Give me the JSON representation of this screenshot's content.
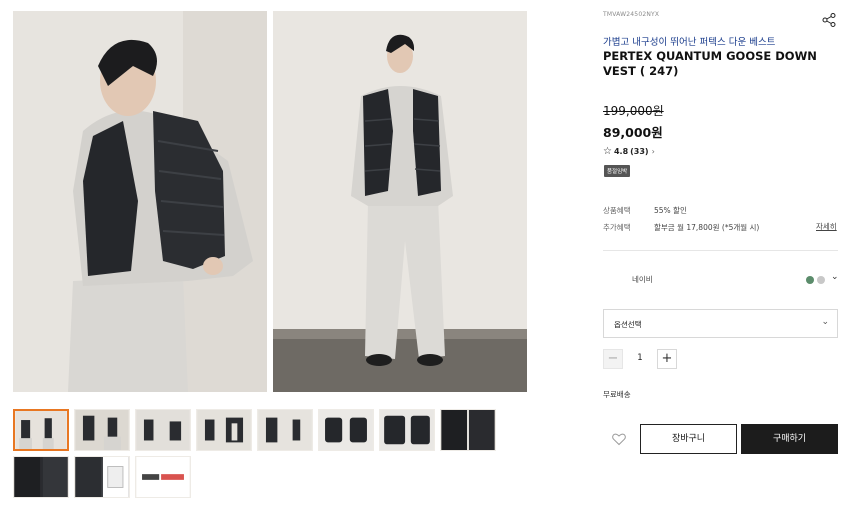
{
  "product": {
    "sku": "TMVAW24502NYX",
    "subtitle": "가볍고 내구성이 뛰어난 퍼텍스 다운 베스트",
    "title": "PERTEX QUANTUM GOOSE DOWN VEST ( 247)",
    "original_price": "199,000원",
    "sale_price": "89,000원",
    "rating": "4.8",
    "review_count": "(33)",
    "badge": "품절임박"
  },
  "benefits": [
    {
      "label": "상품혜택",
      "value": "55% 할인"
    },
    {
      "label": "추가혜택",
      "value": "할부금 월 17,800원 (*5개월 시)"
    }
  ],
  "detail_link": "자세히",
  "color": {
    "label": "네이비",
    "swatches": [
      "#5b8c6b",
      "#c8c8c8"
    ]
  },
  "option_select": {
    "label": "옵션선택"
  },
  "quantity": {
    "value": "1",
    "minus": "−",
    "plus": "+"
  },
  "shipping": "무료배송",
  "actions": {
    "cart": "장바구니",
    "buy": "구매하기"
  },
  "icons": {
    "share": "share-icon",
    "wishlist": "heart-icon",
    "star": "star-icon"
  },
  "colors": {
    "accent": "#e87722",
    "subtitle": "#1a3c8c",
    "buy_button": "#1c1c1c"
  }
}
